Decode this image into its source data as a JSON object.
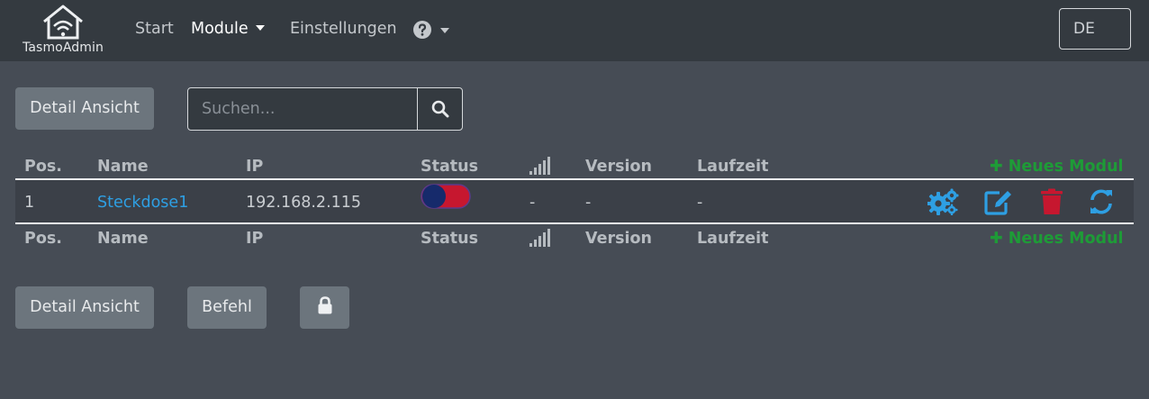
{
  "brand": {
    "name": "TasmoAdmin"
  },
  "nav": {
    "items": [
      {
        "label": "Start"
      },
      {
        "label": "Module",
        "active": true
      },
      {
        "label": "Einstellungen"
      }
    ],
    "help_icon": "question-circle-icon",
    "language": "DE"
  },
  "toolbar": {
    "detail_view_label": "Detail Ansicht",
    "search_placeholder": "Suchen...",
    "search_icon": "search-icon"
  },
  "table": {
    "columns": [
      "Pos.",
      "Name",
      "IP",
      "Status",
      "Version",
      "Laufzeit"
    ],
    "signal_icon": "signal-icon",
    "new_module_label": "Neues Modul",
    "rows": [
      {
        "pos": "1",
        "name": "Steckdose1",
        "ip": "192.168.2.115",
        "status": "toggle",
        "signal": "-",
        "version": "-",
        "uptime": "-"
      }
    ],
    "row_actions": [
      "cogs-icon",
      "edit-icon",
      "trash-icon",
      "sync-icon"
    ]
  },
  "footer_toolbar": {
    "detail_view_label": "Detail Ansicht",
    "command_label": "Befehl",
    "lock_icon": "lock-icon"
  },
  "colors": {
    "nav_bg": "#343a40",
    "page_bg": "#464c55",
    "link": "#2e9fe3",
    "success": "#1e9b37",
    "danger": "#c6172f",
    "toggle_off": "#162a6b"
  }
}
